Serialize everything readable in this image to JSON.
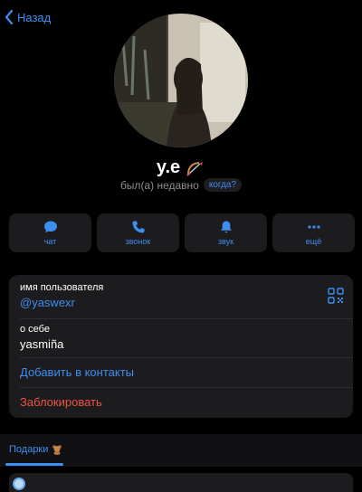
{
  "header": {
    "back_label": "Назад"
  },
  "profile": {
    "name": "y.e",
    "status": "был(а) недавно",
    "when_label": "когда?"
  },
  "actions": [
    {
      "label": "чат",
      "icon": "chat-bubble-icon"
    },
    {
      "label": "звонок",
      "icon": "phone-icon"
    },
    {
      "label": "звук",
      "icon": "bell-icon"
    },
    {
      "label": "ещё",
      "icon": "more-dots-icon"
    }
  ],
  "info": {
    "username_label": "имя пользователя",
    "username_value": "@yaswexr",
    "about_label": "о себе",
    "about_value": "yasmiña",
    "add_contact": "Добавить в контакты",
    "block": "Заблокировать"
  },
  "tabs": {
    "gifts_label": "Подарки"
  },
  "colors": {
    "accent": "#3e8ef0",
    "danger": "#eb5545",
    "card": "#1c1c1e",
    "background": "#000000"
  }
}
